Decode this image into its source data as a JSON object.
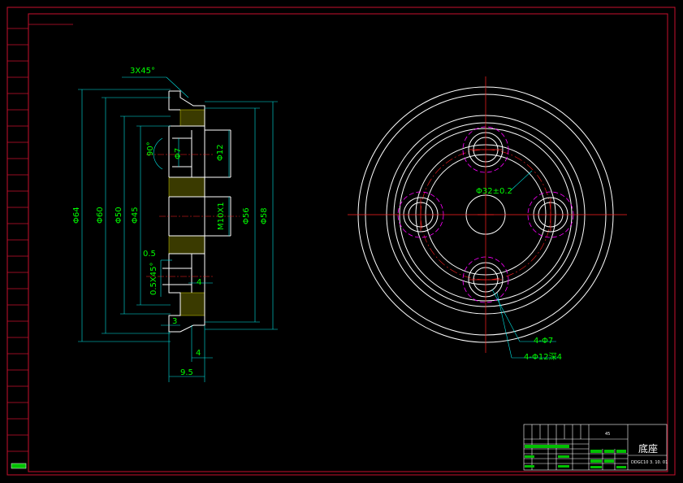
{
  "colors": {
    "background": "#000000",
    "border": "#c8102e",
    "outline": "#ffffff",
    "center": "#ff2020",
    "dimension": "#00e5e5",
    "dim_text": "#00ff00",
    "hatch": "#ffff00",
    "construction": "#ff00ff"
  },
  "section_view": {
    "chamfer_label": "3X45°",
    "angle_label": "90°",
    "dia_labels": {
      "d64": "Φ64",
      "d60": "Φ60",
      "d50": "Φ50",
      "d45": "Φ45",
      "d7": "Φ7",
      "d12": "Φ12",
      "m10": "M10X1",
      "d56": "Φ56",
      "d58": "Φ58"
    },
    "small_labels": {
      "v05": "0.5",
      "chamfer05": "0.5X45°",
      "four_a": "4",
      "three": "3",
      "four_b": "4",
      "nine_five": "9.5"
    }
  },
  "front_view": {
    "pcd_label": "Φ32±0.2",
    "hole_label_a": "4-Φ7",
    "hole_label_b": "4-Φ12深4"
  },
  "title_block": {
    "material": "45",
    "part_name": "底座",
    "drawing_no": "DDGC10 3. 10. 01"
  }
}
